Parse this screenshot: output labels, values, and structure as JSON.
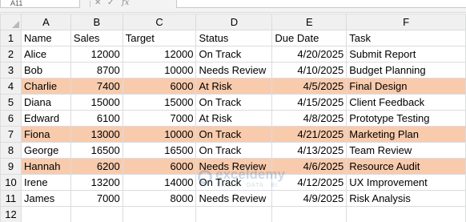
{
  "formula_bar": {
    "name_box": "A11",
    "cancel_icon": "✕",
    "confirm_icon": "✓",
    "function_label": "fx",
    "formula": ""
  },
  "columns": [
    "A",
    "B",
    "C",
    "D",
    "E",
    "F"
  ],
  "headers": [
    "Name",
    "Sales",
    "Target",
    "Status",
    "Due Date",
    "Task"
  ],
  "rows": [
    {
      "num": "2",
      "name": "Alice",
      "sales": "12000",
      "target": "12000",
      "status": "On Track",
      "due": "4/20/2025",
      "task": "Submit Report",
      "highlight": false
    },
    {
      "num": "3",
      "name": "Bob",
      "sales": "8700",
      "target": "10000",
      "status": "Needs Review",
      "due": "4/10/2025",
      "task": "Budget Planning",
      "highlight": false
    },
    {
      "num": "4",
      "name": "Charlie",
      "sales": "7400",
      "target": "6000",
      "status": "At Risk",
      "due": "4/5/2025",
      "task": "Final Design",
      "highlight": true
    },
    {
      "num": "5",
      "name": "Diana",
      "sales": "15000",
      "target": "15000",
      "status": "On Track",
      "due": "4/15/2025",
      "task": "Client Feedback",
      "highlight": false
    },
    {
      "num": "6",
      "name": "Edward",
      "sales": "6100",
      "target": "7000",
      "status": "At Risk",
      "due": "4/8/2025",
      "task": "Prototype Testing",
      "highlight": false
    },
    {
      "num": "7",
      "name": "Fiona",
      "sales": "13000",
      "target": "10000",
      "status": "On Track",
      "due": "4/21/2025",
      "task": "Marketing Plan",
      "highlight": true
    },
    {
      "num": "8",
      "name": "George",
      "sales": "16500",
      "target": "16500",
      "status": "On Track",
      "due": "4/13/2025",
      "task": "Team Review",
      "highlight": false
    },
    {
      "num": "9",
      "name": "Hannah",
      "sales": "6200",
      "target": "6000",
      "status": "Needs Review",
      "due": "4/6/2025",
      "task": "Resource Audit",
      "highlight": true
    },
    {
      "num": "10",
      "name": "Irene",
      "sales": "13200",
      "target": "14000",
      "status": "On Track",
      "due": "4/12/2025",
      "task": "UX Improvement",
      "highlight": false
    },
    {
      "num": "11",
      "name": "James",
      "sales": "7000",
      "target": "8000",
      "status": "Needs Review",
      "due": "4/9/2025",
      "task": "Risk Analysis",
      "highlight": false
    }
  ],
  "empty_row_num": "12",
  "header_row_num": "1",
  "colors": {
    "highlight": "#f8cbad",
    "header_bg": "#f0f0f0",
    "gridline": "#dadcdf"
  },
  "watermark": {
    "name": "exceldemy",
    "tagline": "EXCEL · DATA · BI"
  }
}
